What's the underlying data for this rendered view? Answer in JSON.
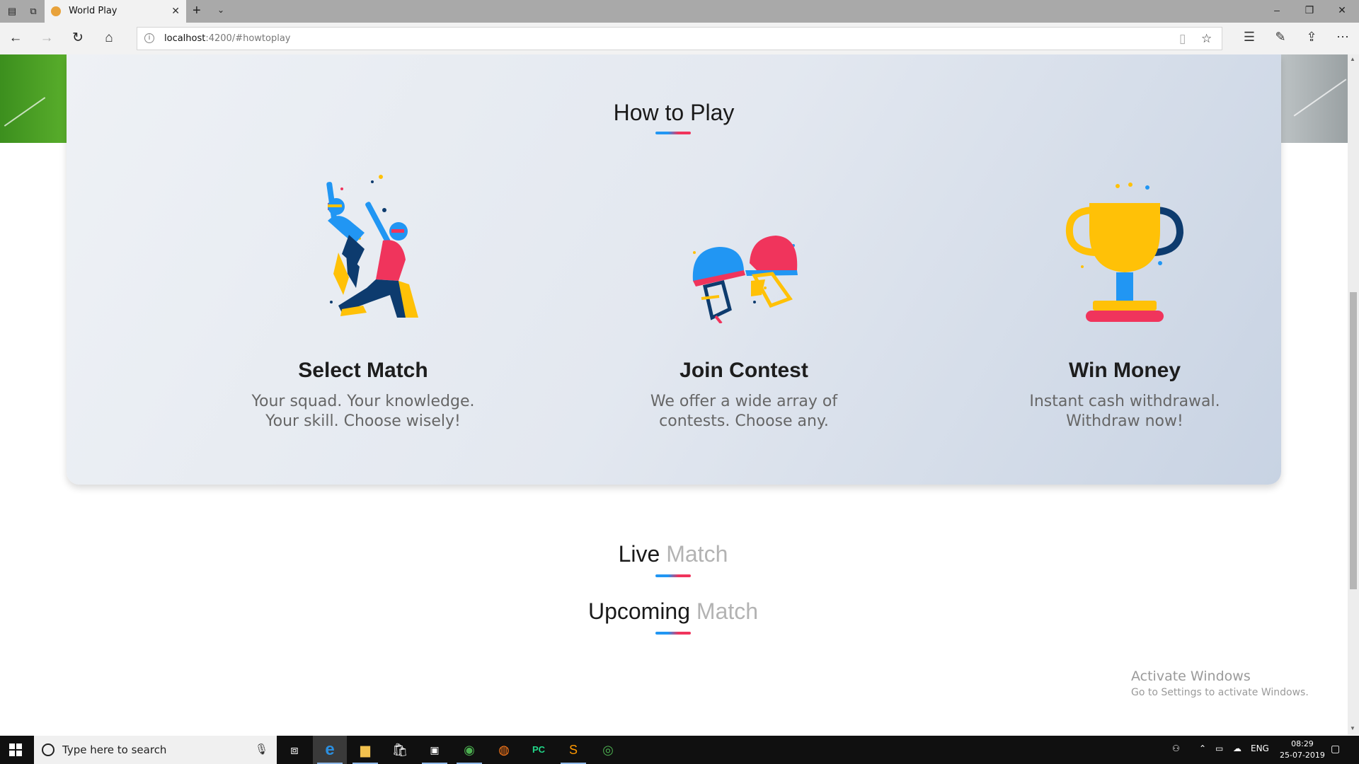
{
  "browser": {
    "tab_title": "World Play",
    "address_host": "localhost",
    "address_rest": ":4200/#howtoplay"
  },
  "how_to_play": {
    "title": "How to Play",
    "steps": [
      {
        "title": "Select Match",
        "desc_line1": "Your squad. Your knowledge.",
        "desc_line2": "Your skill. Choose wisely!",
        "icon": "cricketers-icon"
      },
      {
        "title": "Join Contest",
        "desc_line1": "We offer a wide array of",
        "desc_line2": "contests. Choose any.",
        "icon": "helmets-icon"
      },
      {
        "title": "Win Money",
        "desc_line1": "Instant cash withdrawal.",
        "desc_line2": "Withdraw now!",
        "icon": "trophy-icon"
      }
    ]
  },
  "live": {
    "strong": "Live",
    "light": "Match"
  },
  "upcoming": {
    "strong": "Upcoming",
    "light": "Match"
  },
  "watermark": {
    "line1": "Activate Windows",
    "line2": "Go to Settings to activate Windows."
  },
  "taskbar": {
    "search_placeholder": "Type here to search",
    "language": "ENG",
    "time": "08:29",
    "date": "25-07-2019"
  },
  "colors": {
    "accent_blue": "#2196f3",
    "accent_pink": "#f0345c",
    "trophy_gold": "#ffc107",
    "navy": "#0d3b6e"
  }
}
